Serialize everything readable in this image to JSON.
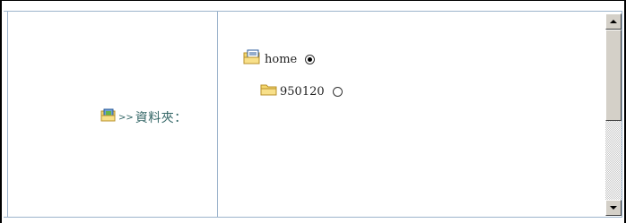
{
  "form": {
    "folder_label": "資料夾：",
    "folder_label_prefix": ">>"
  },
  "folder_tree": {
    "nodes": [
      {
        "label": "home",
        "selected": true
      },
      {
        "label": "950120",
        "selected": false
      }
    ]
  },
  "colors": {
    "grid_line": "#9cb4cc",
    "label_text": "#336666",
    "folder_yellow": "#f5d76e"
  }
}
